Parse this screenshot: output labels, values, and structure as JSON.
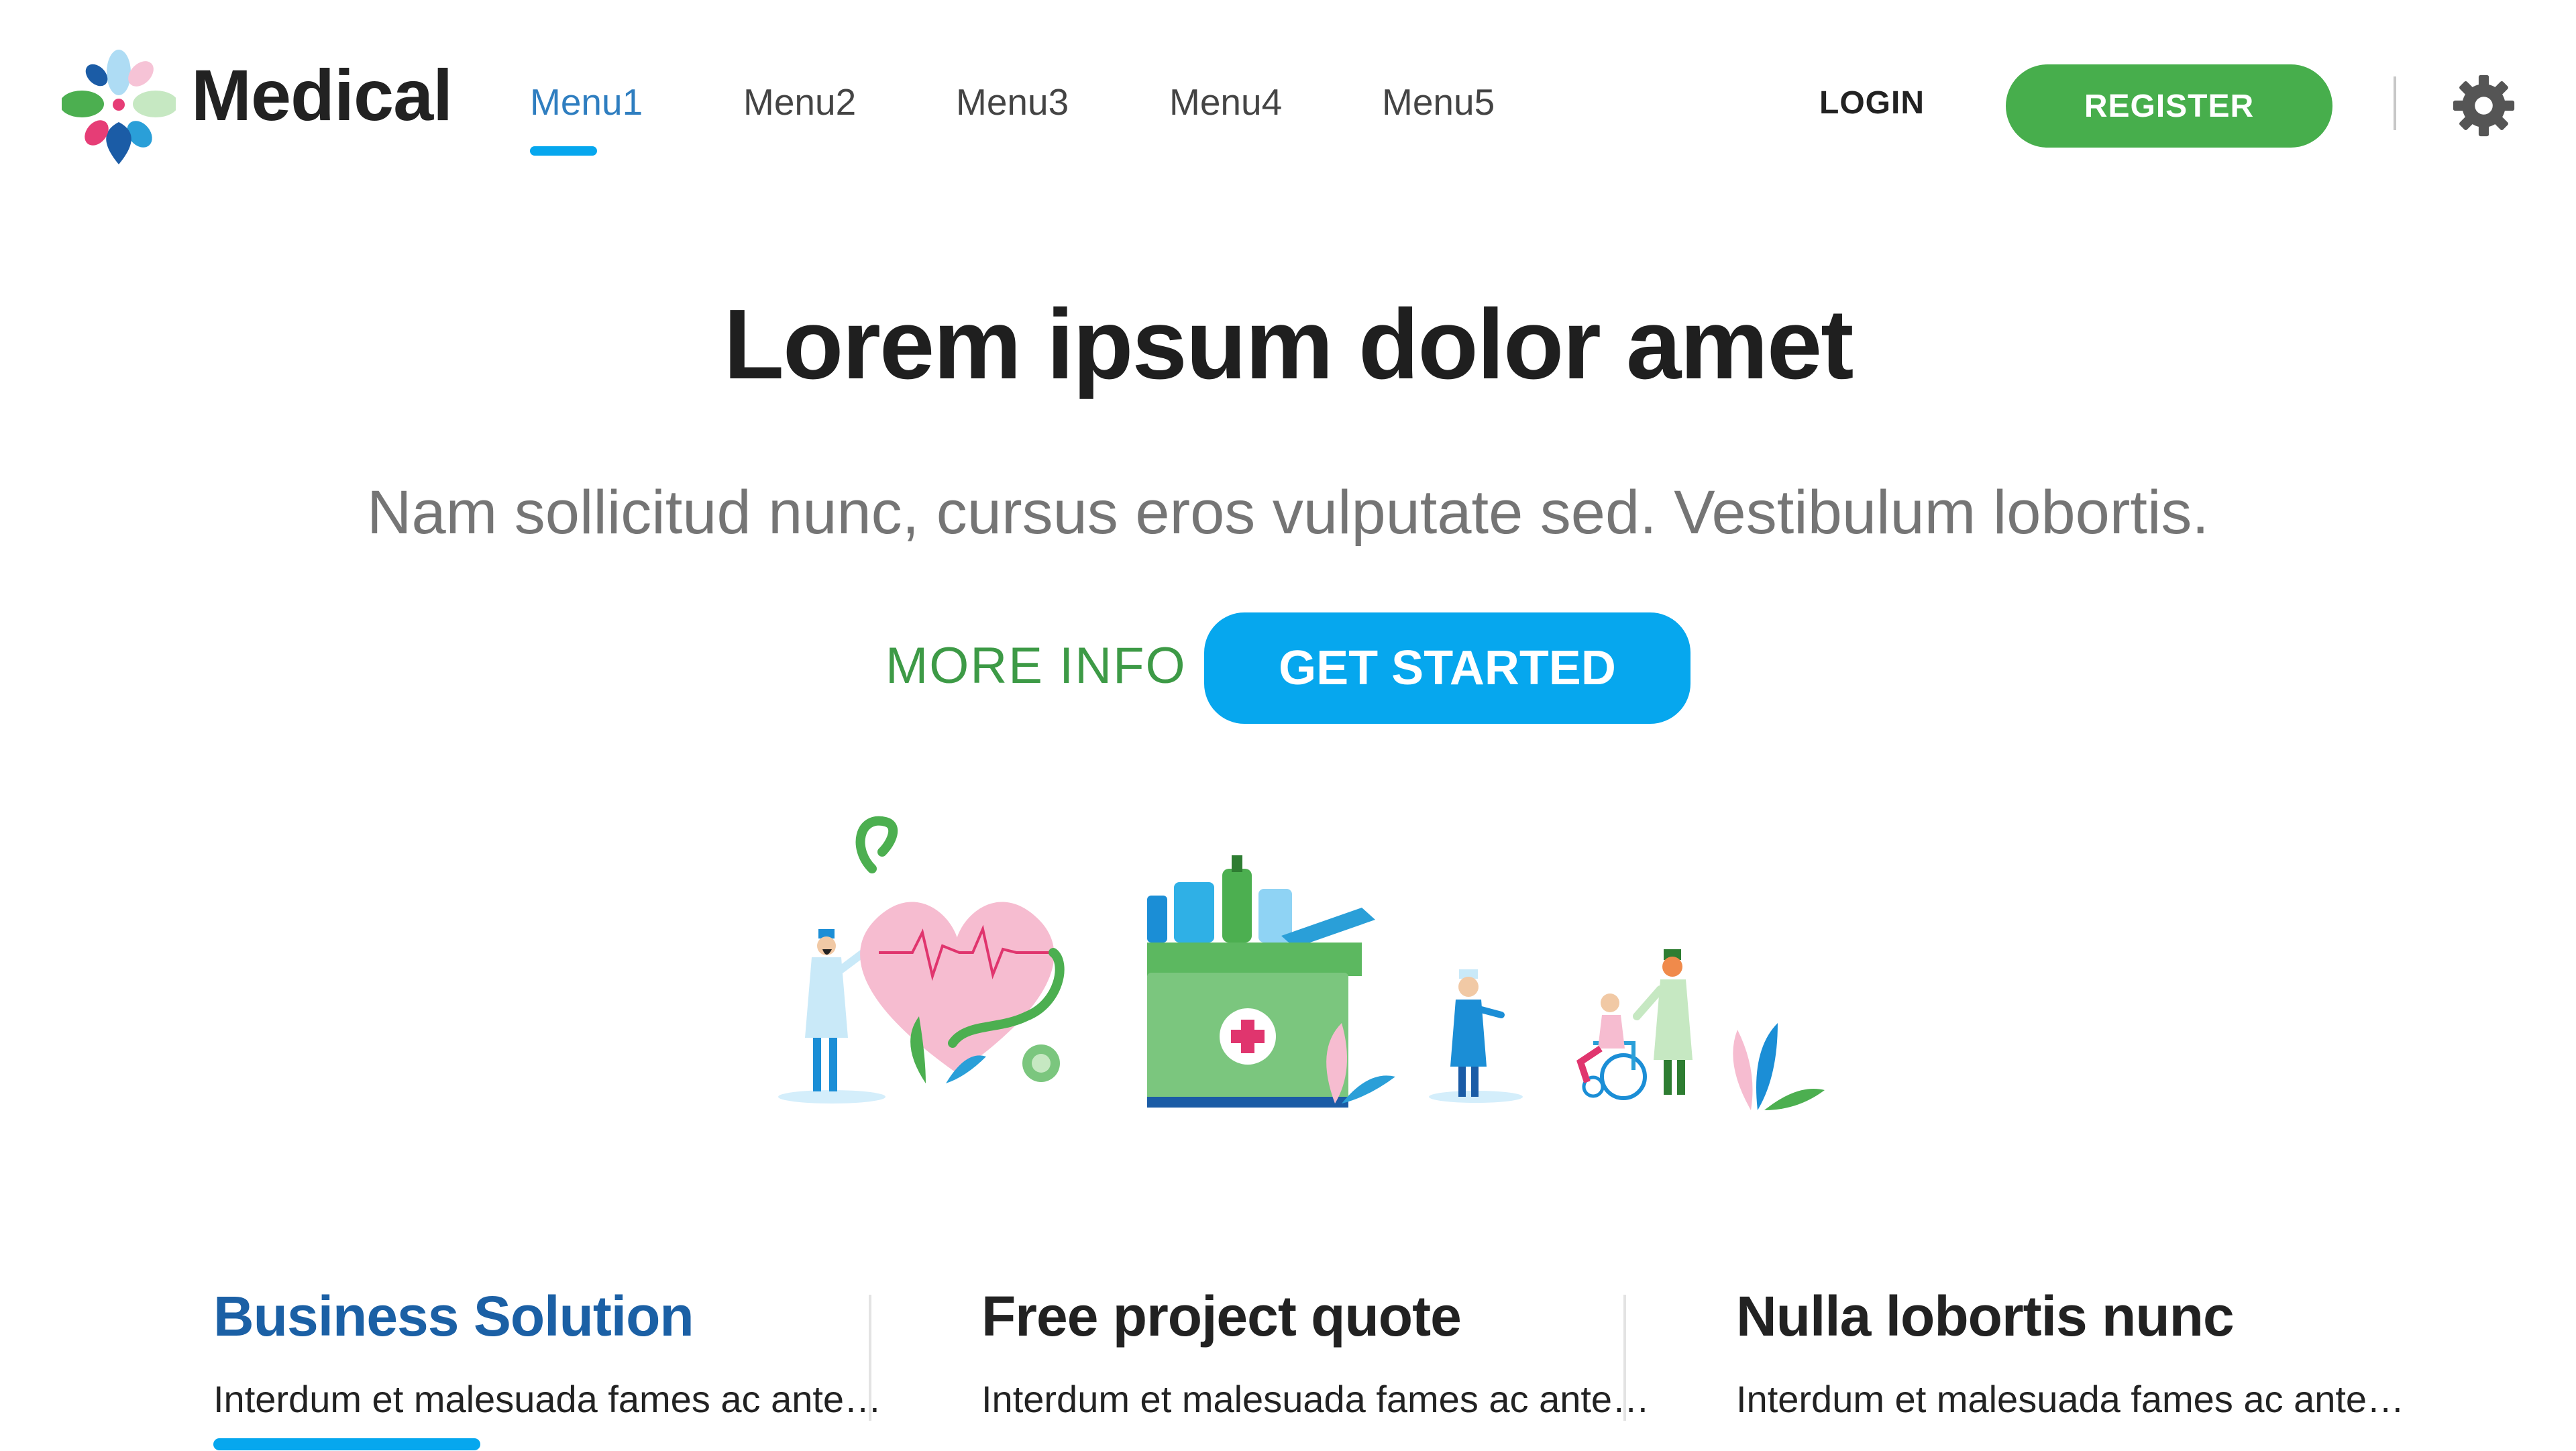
{
  "header": {
    "brand": "Medical",
    "nav": [
      "Menu1",
      "Menu2",
      "Menu3",
      "Menu4",
      "Menu5"
    ],
    "active_nav": "Menu1",
    "login_label": "LOGIN",
    "register_label": "REGISTER",
    "settings_icon": "gear-icon"
  },
  "hero": {
    "title": "Lorem ipsum dolor amet",
    "subtitle": "Nam sollicitud nunc, cursus eros vulputate sed. Vestibulum lobortis.",
    "more_info_label": "MORE INFO",
    "get_started_label": "GET STARTED"
  },
  "cards": [
    {
      "title": "Business Solution",
      "text": "Interdum et malesuada fames ac ante…",
      "active": true
    },
    {
      "title": "Free project quote",
      "text": "Interdum et malesuada fames ac ante…",
      "active": false
    },
    {
      "title": "Nulla lobortis nunc",
      "text": "Interdum et malesuada fames ac ante…",
      "active": false
    }
  ],
  "colors": {
    "accent_blue": "#06a7ee",
    "active_title_blue": "#1b60a5",
    "nav_active": "#2f7ec0",
    "green": "#47ae4c",
    "more_info_green": "#3d9a46",
    "text_dark": "#222222",
    "text_muted": "#757575"
  }
}
